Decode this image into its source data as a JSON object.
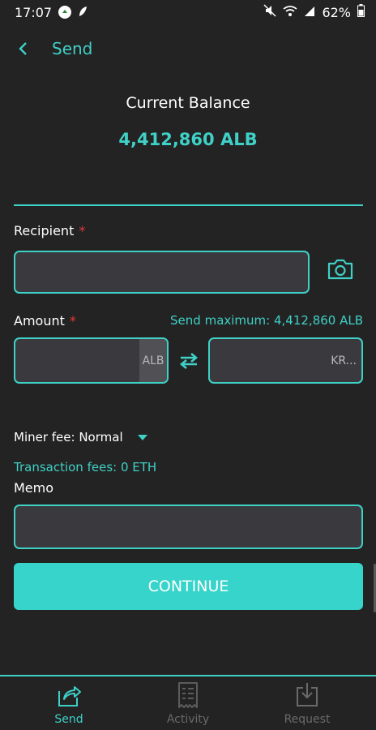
{
  "status_bar": {
    "time": "17:07",
    "battery": "62%"
  },
  "header": {
    "title": "Send",
    "back_icon": "chevron-left-icon"
  },
  "balance": {
    "label": "Current Balance",
    "value": "4,412,860 ALB"
  },
  "recipient": {
    "label": "Recipient",
    "required_mark": "*",
    "value": "",
    "camera_icon": "camera-icon"
  },
  "amount": {
    "label": "Amount",
    "required_mark": "*",
    "send_max": "Send maximum: 4,412,860 ALB",
    "crypto_value": "",
    "crypto_unit": "ALB",
    "fiat_value": "",
    "fiat_unit": "KR...",
    "swap_icon": "swap-arrows-icon"
  },
  "miner_fee": {
    "label": "Miner fee: Normal",
    "dropdown_icon": "caret-down-icon"
  },
  "transaction_fees": "Transaction fees: 0 ETH",
  "memo": {
    "label": "Memo",
    "value": ""
  },
  "continue_button": "CONTINUE",
  "bottom_nav": {
    "items": [
      {
        "label": "Send",
        "icon": "share-icon",
        "active": true
      },
      {
        "label": "Activity",
        "icon": "receipt-icon",
        "active": false
      },
      {
        "label": "Request",
        "icon": "download-icon",
        "active": false
      }
    ]
  },
  "colors": {
    "background": "#232323",
    "accent": "#3fd0c6",
    "button": "#36d4ca",
    "input_bg": "#3a3a3e",
    "required": "#e53935"
  }
}
